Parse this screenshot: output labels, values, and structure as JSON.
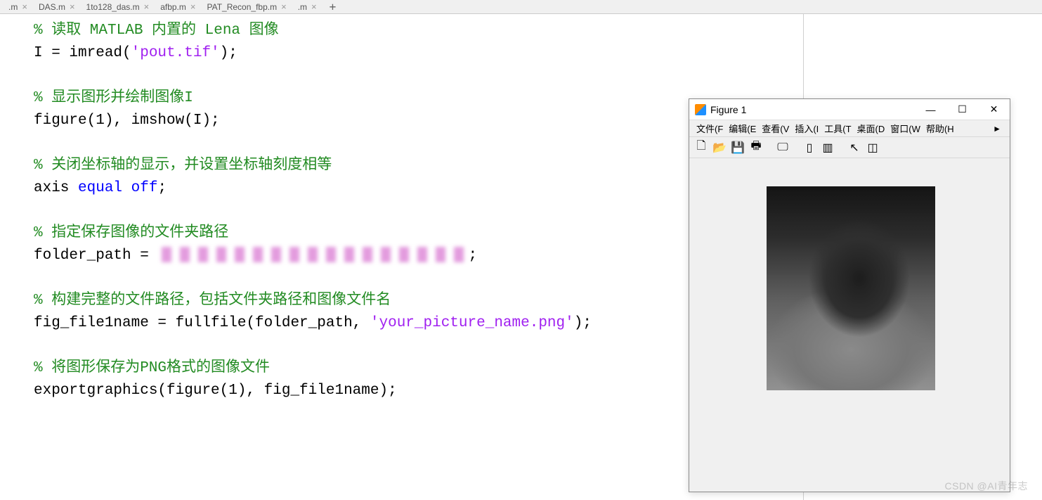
{
  "tabs": [
    {
      "label": ".m"
    },
    {
      "label": "DAS.m"
    },
    {
      "label": "1to128_das.m"
    },
    {
      "label": "afbp.m"
    },
    {
      "label": "PAT_Recon_fbp.m"
    },
    {
      "label": ".m"
    }
  ],
  "code": {
    "l1_comment": "% 读取 MATLAB 内置的 Lena 图像",
    "l2a": "I = imread(",
    "l2b": "'pout.tif'",
    "l2c": ");",
    "l3_comment": "% 显示图形并绘制图像I",
    "l4a": "figure(1), imshow(I);",
    "l5_comment": "% 关闭坐标轴的显示，并设置坐标轴刻度相等",
    "l6a": "axis ",
    "l6b": "equal off",
    "l6c": ";",
    "l7_comment": "% 指定保存图像的文件夹路径",
    "l8a": "folder_path = ",
    "l8b": ";",
    "l9_comment": "% 构建完整的文件路径，包括文件夹路径和图像文件名",
    "l10a": "fig_file1name = fullfile(folder_path, ",
    "l10b": "'your_picture_name.png'",
    "l10c": ");",
    "l11_comment": "% 将图形保存为PNG格式的图像文件",
    "l12a": "exportgraphics(figure(1), fig_file1name);"
  },
  "figure": {
    "title": "Figure 1",
    "menu": {
      "file": "文件(F",
      "edit": "编辑(E",
      "view": "查看(V",
      "insert": "插入(I",
      "tools": "工具(T",
      "desktop": "桌面(D",
      "window": "窗口(W",
      "help": "帮助(H"
    },
    "toolbar_icons": {
      "new": "🗋",
      "open": "📂",
      "save": "💾",
      "print": "🖶",
      "sep": "",
      "zoom": "🖵",
      "sep2": "",
      "rotate": "▯",
      "datacursor": "▥",
      "pointer": "↖",
      "paninsert": "◫"
    },
    "winbtn": {
      "min": "—",
      "max": "☐",
      "close": "✕"
    }
  },
  "watermark": "CSDN @AI青年志"
}
